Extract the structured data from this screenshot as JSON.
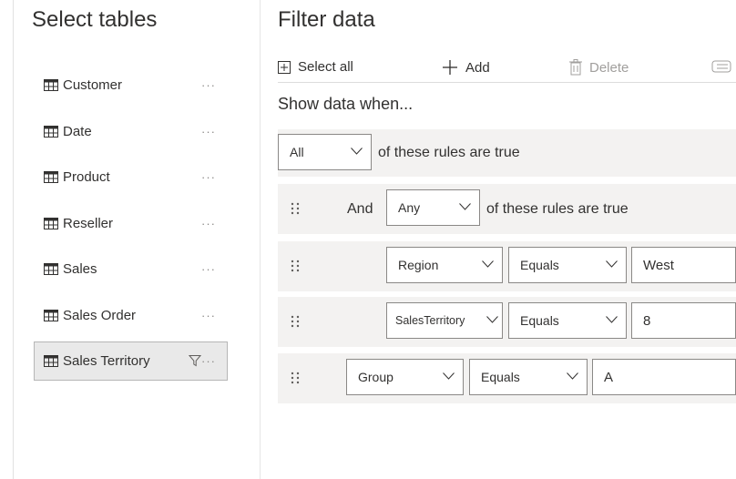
{
  "left_panel": {
    "title": "Select tables",
    "tables": [
      {
        "label": "Customer",
        "more": "···"
      },
      {
        "label": "Date",
        "more": "···"
      },
      {
        "label": "Product",
        "more": "···"
      },
      {
        "label": "Reseller",
        "more": "···"
      },
      {
        "label": "Sales",
        "more": "···"
      },
      {
        "label": "Sales Order",
        "more": "···"
      },
      {
        "label": "Sales Territory",
        "more": "···",
        "selected": true
      }
    ]
  },
  "filter_panel": {
    "title": "Filter data",
    "toolbar": {
      "select_all": "Select all",
      "add": "Add",
      "delete": "Delete"
    },
    "show_when": "Show data when...",
    "root": {
      "quantifier": "All",
      "suffix": "of these rules are true"
    },
    "group": {
      "connector": "And",
      "quantifier": "Any",
      "suffix": "of these rules are true"
    },
    "rules": [
      {
        "field": "Region",
        "operator": "Equals",
        "value": "West"
      },
      {
        "field": "SalesTerritory",
        "operator": "Equals",
        "value": "8"
      },
      {
        "field": "Group",
        "operator": "Equals",
        "value": "A"
      }
    ]
  },
  "colors": {
    "selected_bg": "#e9e9e9",
    "row_bg": "#f3f2f1",
    "border": "#8a8886"
  }
}
